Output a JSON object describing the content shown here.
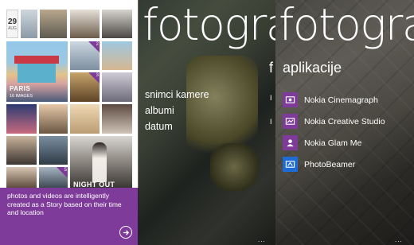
{
  "colors": {
    "accent_purple": "#7e3b9a",
    "photobeamer_blue": "#1e6bd6",
    "text_white": "#ffffff"
  },
  "story": {
    "date_day": "29",
    "date_month": "AUG",
    "tiles_badges": [
      "2",
      "3",
      "2",
      "5"
    ],
    "paris_title": "PARIS",
    "paris_count": "16 IMAGES",
    "night_out": "NIGHT OUT",
    "info_text": "photos and videos are intelligently created as a Story based on their time and location",
    "next_icon": "arrow-right-circle-icon"
  },
  "hub": {
    "title": "fotografije",
    "nav_items": [
      "snimci kamere",
      "albumi",
      "datum"
    ],
    "peek_section": "f",
    "peek_items": [
      "I",
      "I"
    ],
    "more_dots": "..."
  },
  "apps": {
    "title": "fotografije",
    "section": "aplikacije",
    "items": [
      {
        "label": "Nokia Cinemagraph",
        "icon": "cinemagraph-icon",
        "color": "#7e3b9a"
      },
      {
        "label": "Nokia Creative Studio",
        "icon": "creative-studio-icon",
        "color": "#7e3b9a"
      },
      {
        "label": "Nokia Glam Me",
        "icon": "glam-me-icon",
        "color": "#7e3b9a"
      },
      {
        "label": "PhotoBeamer",
        "icon": "photobeamer-icon",
        "color": "#1e6bd6"
      }
    ],
    "more_dots": "..."
  }
}
